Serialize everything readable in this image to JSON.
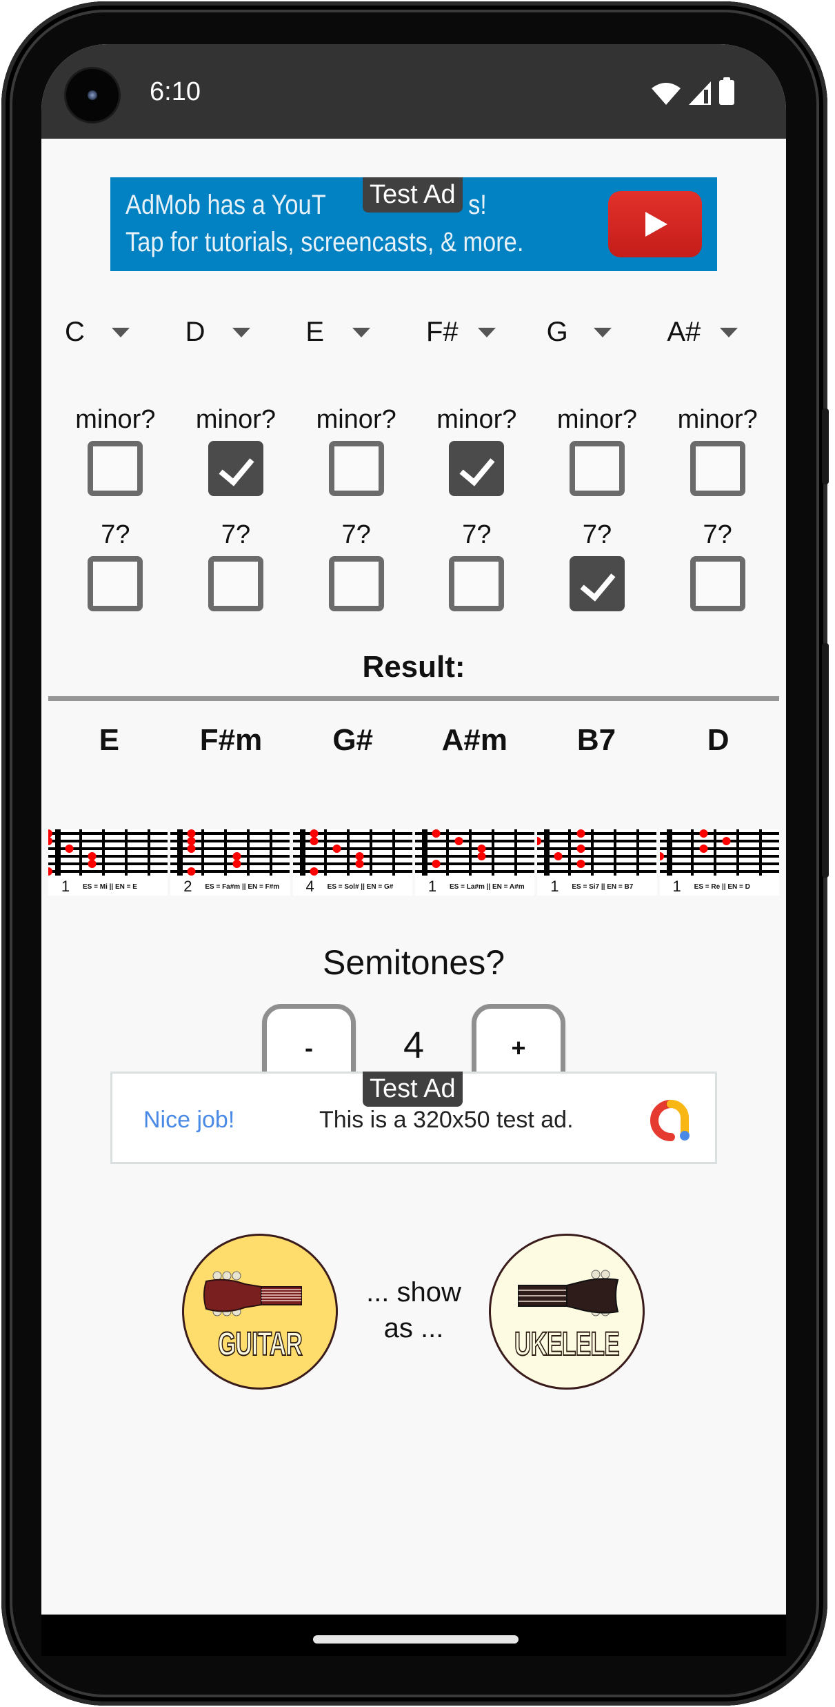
{
  "status_bar": {
    "time": "6:10",
    "icons": [
      "wifi-icon",
      "cellular-signal-icon",
      "battery-icon"
    ]
  },
  "ad_top": {
    "badge": "Test Ad",
    "line1_visible_start": "AdMob has a YouT",
    "line1_visible_end": "s!",
    "line2": "Tap for tutorials, screencasts, & more.",
    "icon": "youtube-play-icon",
    "background_color": "#0281c3"
  },
  "chord_selectors": [
    {
      "note": "C",
      "minor": false,
      "seventh": false
    },
    {
      "note": "D",
      "minor": true,
      "seventh": false
    },
    {
      "note": "E",
      "minor": false,
      "seventh": false
    },
    {
      "note": "F#",
      "minor": true,
      "seventh": false
    },
    {
      "note": "G",
      "minor": false,
      "seventh": true
    },
    {
      "note": "A#",
      "minor": false,
      "seventh": false
    }
  ],
  "labels": {
    "minor": "minor?",
    "seventh": "7?",
    "result": "Result:",
    "semitones": "Semitones?",
    "show_as": "... show as ..."
  },
  "result_chords": [
    {
      "name": "E",
      "base_fret": "1",
      "names_caption": "ES = Mi || EN = E",
      "dots": [
        [
          1,
          0
        ],
        [
          2,
          0
        ],
        [
          3,
          1
        ],
        [
          4,
          2
        ],
        [
          5,
          2
        ],
        [
          6,
          0
        ]
      ]
    },
    {
      "name": "F#m",
      "base_fret": "2",
      "names_caption": "ES = Fa#m || EN = F#m",
      "dots": [
        [
          1,
          1
        ],
        [
          2,
          1
        ],
        [
          3,
          1
        ],
        [
          4,
          3
        ],
        [
          5,
          3
        ],
        [
          6,
          1
        ]
      ]
    },
    {
      "name": "G#",
      "base_fret": "4",
      "names_caption": "ES = Sol# || EN = G#",
      "dots": [
        [
          1,
          1
        ],
        [
          2,
          1
        ],
        [
          3,
          2
        ],
        [
          4,
          3
        ],
        [
          5,
          3
        ],
        [
          6,
          1
        ]
      ]
    },
    {
      "name": "A#m",
      "base_fret": "1",
      "names_caption": "ES = La#m || EN = A#m",
      "dots": [
        [
          1,
          1
        ],
        [
          2,
          2
        ],
        [
          3,
          3
        ],
        [
          4,
          3
        ],
        [
          5,
          1
        ]
      ]
    },
    {
      "name": "B7",
      "base_fret": "1",
      "names_caption": "ES = Si7 || EN = B7",
      "dots": [
        [
          1,
          2
        ],
        [
          2,
          0
        ],
        [
          3,
          2
        ],
        [
          4,
          1
        ],
        [
          5,
          2
        ]
      ]
    },
    {
      "name": "D",
      "base_fret": "1",
      "names_caption": "ES = Re || EN = D",
      "dots": [
        [
          1,
          2
        ],
        [
          2,
          3
        ],
        [
          3,
          2
        ],
        [
          4,
          0
        ]
      ]
    }
  ],
  "semitones": {
    "minus_label": "-",
    "value": "4",
    "plus_label": "+"
  },
  "ad_bottom": {
    "badge": "Test Ad",
    "headline": "Nice job!",
    "message": "This is a 320x50 test ad.",
    "icon": "admob-logo-icon",
    "headline_color": "#4a8ae6"
  },
  "instruments": {
    "guitar_label": "GUITAR",
    "ukulele_label": "UKELELE",
    "selected": "guitar"
  }
}
